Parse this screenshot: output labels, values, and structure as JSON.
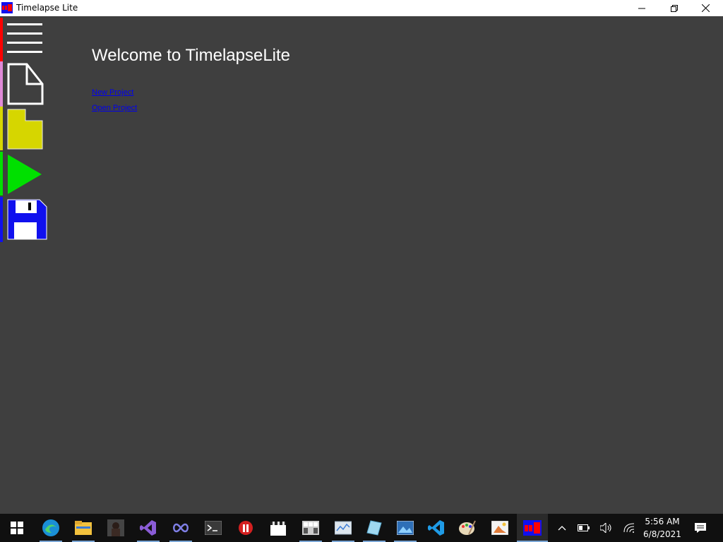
{
  "window": {
    "title": "Timelapse Lite"
  },
  "main": {
    "welcome": "Welcome to TimelapseLite",
    "links": {
      "new_project": "New Project",
      "open_project": "Open Project"
    }
  },
  "sidebar": {
    "items": [
      {
        "name": "menu",
        "icon": "hamburger-menu-icon",
        "color": "#ff0000"
      },
      {
        "name": "new",
        "icon": "new-document-icon",
        "color": "#e08ad8"
      },
      {
        "name": "open",
        "icon": "folder-icon",
        "color": "#d6d600"
      },
      {
        "name": "play",
        "icon": "play-icon",
        "color": "#00e000"
      },
      {
        "name": "save",
        "icon": "floppy-disk-icon",
        "color": "#1010ee"
      }
    ]
  },
  "taskbar": {
    "apps": [
      "windows-start-icon",
      "edge-icon",
      "file-explorer-icon",
      "photo-app-icon",
      "visual-studio-icon",
      "infinity-app-icon",
      "terminal-icon",
      "red-app-icon",
      "clapperboard-icon",
      "grid-app-icon",
      "dashboard-app-icon",
      "crystal-app-icon",
      "photo-viewer-icon",
      "vscode-icon",
      "paint-palette-icon",
      "image-editor-icon",
      "timelapse-lite-icon"
    ],
    "clock": {
      "time": "5:56 AM",
      "date": "6/8/2021"
    }
  }
}
